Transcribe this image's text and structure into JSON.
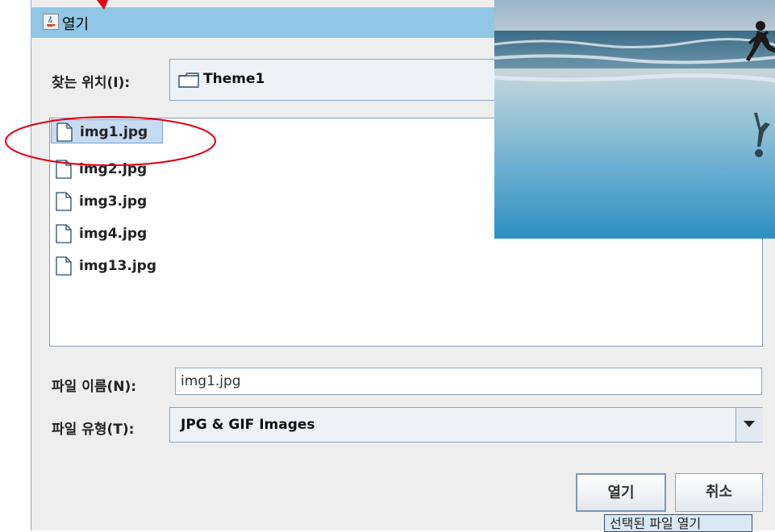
{
  "window": {
    "title": "열기",
    "title_icon": "java-coffee-icon"
  },
  "look_in": {
    "label": "찾는 위치(I):",
    "value": "Theme1",
    "icon": "folder-icon"
  },
  "files": [
    {
      "name": "img1.jpg",
      "icon": "file-icon",
      "selected": true
    },
    {
      "name": "img2.jpg",
      "icon": "file-icon"
    },
    {
      "name": "img3.jpg",
      "icon": "file-icon"
    },
    {
      "name": "img4.jpg",
      "icon": "file-icon"
    },
    {
      "name": "img13.jpg",
      "icon": "file-icon"
    }
  ],
  "file_name": {
    "label": "파일 이름(N):",
    "value": "img1.jpg"
  },
  "file_type": {
    "label": "파일 유형(T):",
    "value": "JPG & GIF Images"
  },
  "buttons": {
    "open": "열기",
    "cancel": "취소"
  },
  "tooltip": "선택된 파일 열기",
  "annotation": {
    "color": "#e00010"
  },
  "colors": {
    "titlebar": "#8fc7e4",
    "selection": "#c6dbf1"
  }
}
